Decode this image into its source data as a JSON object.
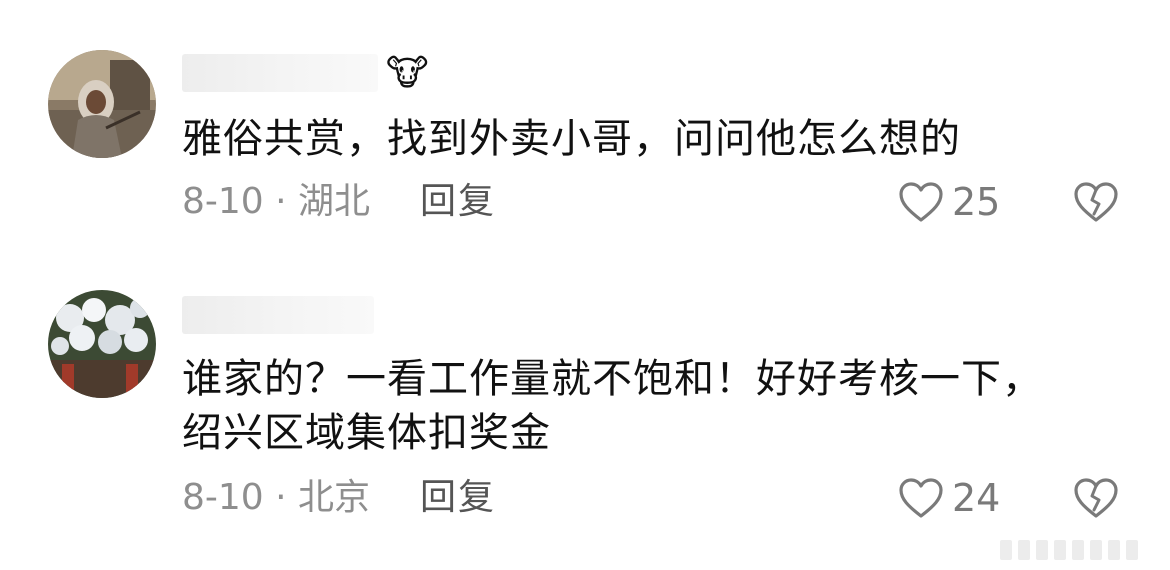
{
  "comments": [
    {
      "badge": "🐮",
      "text": "雅俗共赏，找到外卖小哥，问问他怎么想的",
      "meta": "8-10 · 湖北",
      "reply_label": "回复",
      "likes": "25",
      "avatar_icon": "person-photo-avatar",
      "like_icon": "heart-outline-icon",
      "dislike_icon": "broken-heart-icon"
    },
    {
      "badge": "",
      "text": "谁家的？一看工作量就不饱和！好好考核一下，绍兴区域集体扣奖金",
      "meta": "8-10 · 北京",
      "reply_label": "回复",
      "likes": "24",
      "avatar_icon": "flower-photo-avatar",
      "like_icon": "heart-outline-icon",
      "dislike_icon": "broken-heart-icon"
    }
  ],
  "colors": {
    "text": "#111111",
    "meta": "#8e8e8e",
    "icon": "#7a7a7a"
  }
}
